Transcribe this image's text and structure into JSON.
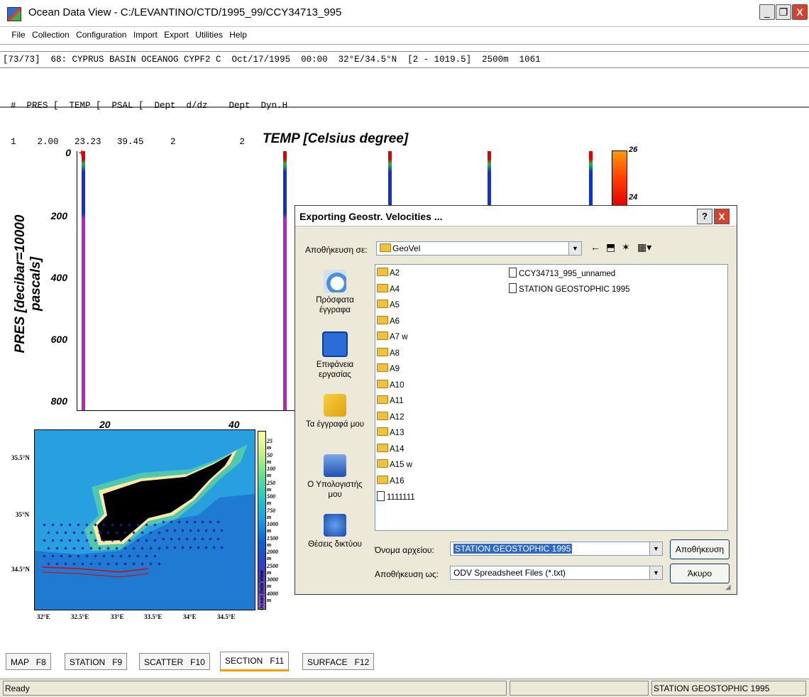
{
  "window": {
    "title": "Ocean Data View - C:/LEVANTINO/CTD/1995_99/CCY34713_995",
    "minimize": "_",
    "maximize": "❐",
    "close": "X"
  },
  "menu": [
    "File",
    "Collection",
    "Configuration",
    "Import",
    "Export",
    "Utilities",
    "Help"
  ],
  "station_info": "[73/73]  68: CYPRUS BASIN OCEANOG CYPF2 C  Oct/17/1995  00:00  32°E/34.5°N  [2 - 1019.5]  2500m  1061",
  "data_header": "  #  PRES [  TEMP [  PSAL [  Dept  d/dz    Dept  Dyn.H",
  "data_row": "  1    2.00   23.23   39.45     2            2",
  "chart": {
    "title": "TEMP [Celsius degree]",
    "ylabel": "PRES [decibar=10000 pascals]",
    "yticks": [
      "0",
      "200",
      "400",
      "600",
      "800"
    ],
    "xticks": [
      "20",
      "40"
    ],
    "colorbar_ticks": [
      "26",
      "24"
    ]
  },
  "map": {
    "lat_labels": [
      "35.5°N",
      "35°N",
      "34.5°N"
    ],
    "lon_labels": [
      "32°E",
      "32.5°E",
      "33°E",
      "33.5°E",
      "34°E",
      "34.5°E"
    ],
    "depth_labels": [
      "25 m",
      "50 m",
      "100 m",
      "250 m",
      "500 m",
      "750 m",
      "1000 m",
      "1500 m",
      "2000 m",
      "2500 m",
      "3000 m",
      "4000 m"
    ],
    "watermark": "Ocean Data View"
  },
  "dialog": {
    "title": "Exporting Geostr. Velocities ...",
    "help": "?",
    "close": "X",
    "save_in_label": "Αποθήκευση σε:",
    "save_in_value": "GeoVel",
    "places": [
      {
        "label": "Πρόσφατα έγγραφα",
        "icon": "recent-documents-icon"
      },
      {
        "label": "Επιφάνεια εργασίας",
        "icon": "desktop-icon"
      },
      {
        "label": "Τα έγγραφά μου",
        "icon": "my-documents-icon"
      },
      {
        "label": "Ο Υπολογιστής μου",
        "icon": "my-computer-icon"
      },
      {
        "label": "Θέσεις δικτύου",
        "icon": "network-places-icon"
      }
    ],
    "folders": [
      "A2",
      "A4",
      "A5",
      "A6",
      "A7 w",
      "A8",
      "A9",
      "A10",
      "A11",
      "A12",
      "A13",
      "A14",
      "A15 w",
      "A16"
    ],
    "files_col1": [
      "1111111"
    ],
    "files_col2": [
      "CCY34713_995_unnamed",
      "STATION GEOSTOPHIC 1995"
    ],
    "filename_label": "Όνομα αρχείου:",
    "filename_value": "STATION GEOSTOPHIC 1995",
    "savetype_label": "Αποθήκευση ως:",
    "savetype_value": "ODV Spreadsheet Files (*.txt)",
    "save_button": "Αποθήκευση",
    "cancel_button": "Άκυρο"
  },
  "tabs": [
    {
      "label": "MAP   F8"
    },
    {
      "label": "STATION   F9"
    },
    {
      "label": "SCATTER   F10"
    },
    {
      "label": "SECTION   F11"
    },
    {
      "label": "SURFACE   F12"
    }
  ],
  "status": {
    "left": "Ready",
    "right": "STATION GEOSTOPHIC 1995"
  }
}
